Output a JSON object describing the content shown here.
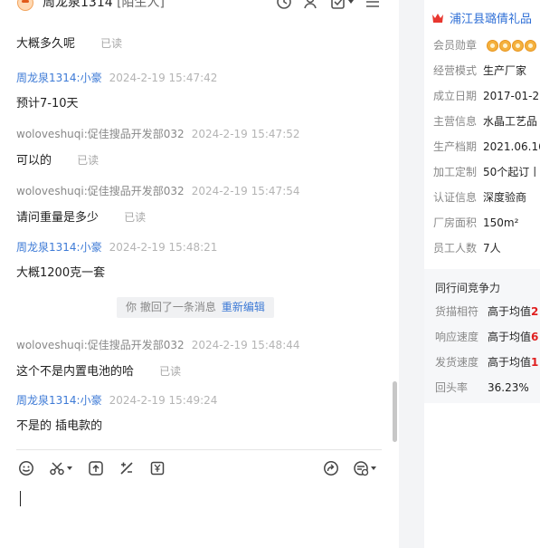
{
  "header": {
    "contact_name": "周龙泉1314",
    "stranger_tag": "[陌生人]"
  },
  "messages": [
    {
      "text": "大概多久呢",
      "read": "已读"
    },
    {
      "sender": "周龙泉1314:小豪",
      "time": "2024-2-19 15:47:42",
      "text": "预计7-10天"
    },
    {
      "sender": "woloveshuqi:促佳搜品开发部032",
      "time": "2024-2-19 15:47:52",
      "text": "可以的",
      "read": "已读"
    },
    {
      "sender": "woloveshuqi:促佳搜品开发部032",
      "time": "2024-2-19 15:47:54",
      "text": "请问重量是多少",
      "read": "已读"
    },
    {
      "sender": "周龙泉1314:小豪",
      "time": "2024-2-19 15:48:21",
      "text": "大概1200克一套"
    },
    {
      "sender": "woloveshuqi:促佳搜品开发部032",
      "time": "2024-2-19 15:48:44",
      "text": "这个不是内置电池的哈",
      "read": "已读"
    },
    {
      "sender": "周龙泉1314:小豪",
      "time": "2024-2-19 15:49:24",
      "text": "不是的 插电款的"
    }
  ],
  "recall_notice": {
    "text": "你 撤回了一条消息",
    "action": "重新编辑"
  },
  "shop": {
    "name": "浦江县璐倩礼品",
    "info": [
      {
        "label": "会员勋章",
        "value": ""
      },
      {
        "label": "经营模式",
        "value": "生产厂家"
      },
      {
        "label": "成立日期",
        "value": "2017-01-26"
      },
      {
        "label": "主营信息",
        "value": "水晶工艺品"
      },
      {
        "label": "生产档期",
        "value": "2021.06.16"
      },
      {
        "label": "加工定制",
        "value": "50个起订丨"
      },
      {
        "label": "认证信息",
        "value": "深度验商"
      },
      {
        "label": "厂房面积",
        "value": "150m²"
      },
      {
        "label": "员工人数",
        "value": "7人"
      }
    ],
    "compete": {
      "title": "同行间竞争力",
      "rows": [
        {
          "label": "货描相符",
          "value": "高于均值",
          "hi": "2"
        },
        {
          "label": "响应速度",
          "value": "高于均值",
          "hi": "6"
        },
        {
          "label": "发货速度",
          "value": "高于均值",
          "hi": "1"
        },
        {
          "label": "回头率",
          "value": "36.23%",
          "hi": ""
        }
      ]
    }
  },
  "colors": {
    "link": "#3d7ad6",
    "highlight": "#e02020",
    "medal": "#f4b13e"
  }
}
